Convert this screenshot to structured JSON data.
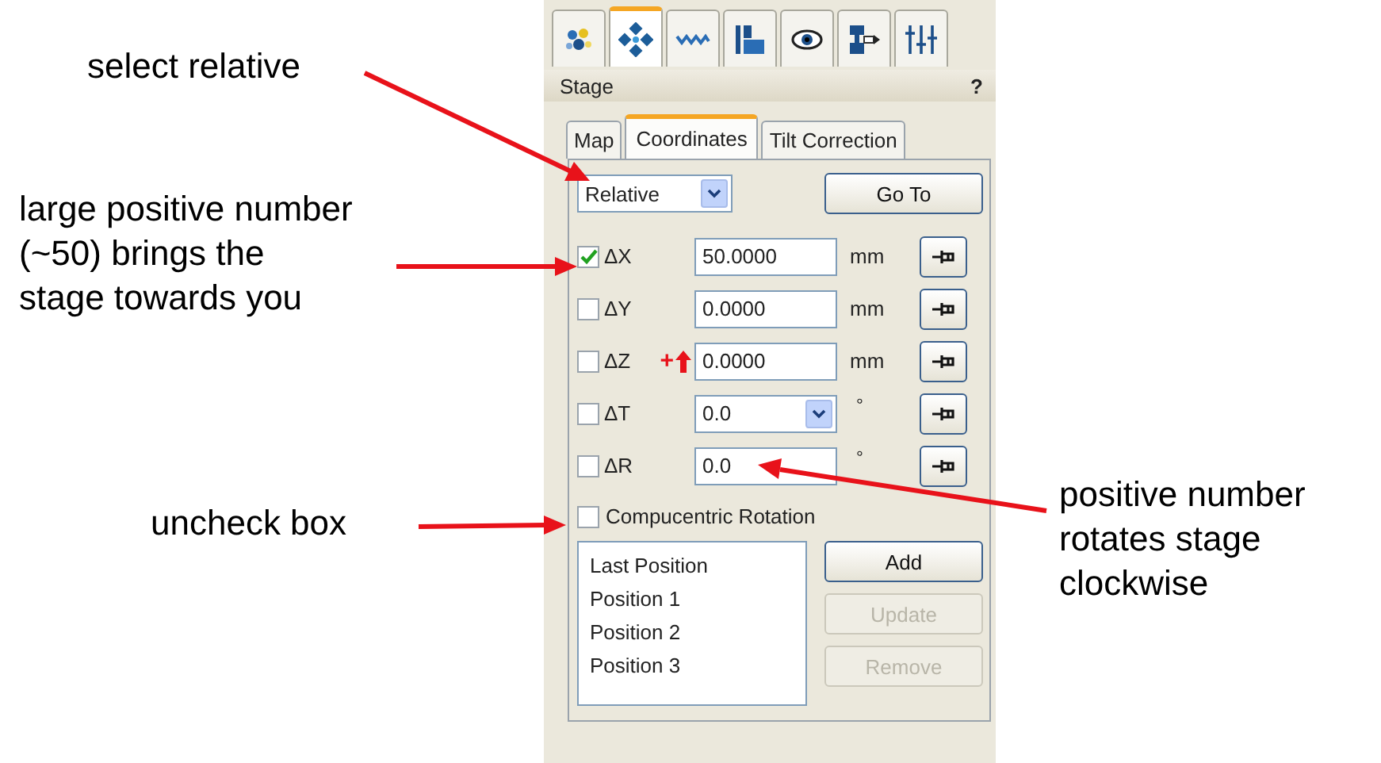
{
  "annotations": [
    {
      "lines": [
        "select relative"
      ]
    },
    {
      "lines": [
        "large positive number",
        "(~50) brings the",
        "stage towards you"
      ]
    },
    {
      "lines": [
        "uncheck box"
      ]
    },
    {
      "lines": [
        "positive number",
        "rotates stage",
        "clockwise"
      ]
    }
  ],
  "panel": {
    "tool_tabs": [
      {
        "selected": false
      },
      {
        "selected": true
      },
      {
        "selected": false
      },
      {
        "selected": false
      },
      {
        "selected": false
      },
      {
        "selected": false
      },
      {
        "selected": false
      }
    ],
    "title": "Stage",
    "help": "?",
    "tabs": [
      {
        "label": "Map",
        "selected": false
      },
      {
        "label": "Coordinates",
        "selected": true
      },
      {
        "label": "Tilt Correction",
        "selected": false
      }
    ],
    "mode": {
      "value": "Relative"
    },
    "go_button": "Go To",
    "axes": [
      {
        "label": "ΔX",
        "checked": true,
        "kind": "text",
        "value": "50.0000",
        "unit": "mm"
      },
      {
        "label": "ΔY",
        "checked": false,
        "kind": "text",
        "value": "0.0000",
        "unit": "mm"
      },
      {
        "label": "ΔZ",
        "checked": false,
        "kind": "text",
        "value": "0.0000",
        "unit": "mm",
        "marker": "+"
      },
      {
        "label": "ΔT",
        "checked": false,
        "kind": "dropdown",
        "value": "0.0",
        "unit": "°"
      },
      {
        "label": "ΔR",
        "checked": false,
        "kind": "text",
        "value": "0.0",
        "unit": "°"
      }
    ],
    "compucentric": {
      "label": "Compucentric Rotation",
      "checked": false
    },
    "positions": [
      "Last Position",
      "Position 1",
      "Position 2",
      "Position 3"
    ],
    "buttons": [
      {
        "label": "Add",
        "disabled": false
      },
      {
        "label": "Update",
        "disabled": true
      },
      {
        "label": "Remove",
        "disabled": true
      }
    ]
  }
}
